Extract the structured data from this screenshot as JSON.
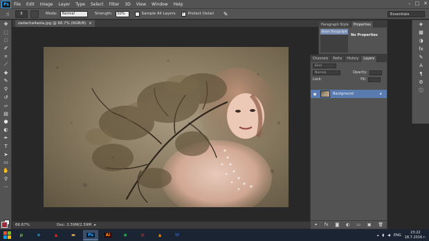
{
  "menubar": {
    "logo": "Ps",
    "items": [
      "File",
      "Edit",
      "Image",
      "Layer",
      "Type",
      "Select",
      "Filter",
      "3D",
      "View",
      "Window",
      "Help"
    ],
    "window_controls": [
      "–",
      "□",
      "✕"
    ]
  },
  "options": {
    "brush_size": "8",
    "mode_label": "Mode:",
    "mode_value": "Normal",
    "strength_label": "Strength:",
    "strength_value": "50%",
    "sample_all_layers": "Sample All Layers",
    "protect_detail": "Protect Detail",
    "workspace": "Essentials"
  },
  "document": {
    "tab_title": "zadacha4aola.jpg @ 66.7% (RGB/8)",
    "close": "×"
  },
  "statusbar": {
    "zoom": "66.67%",
    "doc_info": "Doc: 2.59M/2.59M"
  },
  "paragraph_panel": {
    "tabs": [
      "Paragraph Style",
      "Properties"
    ],
    "style_item": "Basic Paragraph",
    "properties_text": "No Properties"
  },
  "layers_panel": {
    "tabs": [
      "Channels",
      "Paths",
      "History",
      "Layers"
    ],
    "kind_filter": "Kind",
    "blend_mode": "Normal",
    "opacity_label": "Opacity:",
    "lock_label": "Lock:",
    "fill_label": "Fill:",
    "layer_name": "Background"
  },
  "taskbar": {
    "apps": [
      {
        "name": "Ps",
        "color": "#31a8ff",
        "bg": "#001e36",
        "active": true
      },
      {
        "name": "Ai",
        "color": "#ff9a00",
        "bg": "#330000",
        "active": false
      }
    ],
    "language": "ENG",
    "time": "23:22",
    "date": "18.7.2016 г."
  },
  "colors": {
    "foreground": "#a0283b",
    "background": "#f0f0f0",
    "selection": "#5a7bb0"
  }
}
